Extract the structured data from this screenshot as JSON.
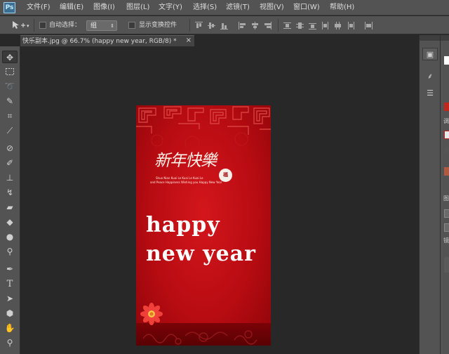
{
  "app": {
    "logo": "Ps"
  },
  "menu": [
    "文件(F)",
    "编辑(E)",
    "图像(I)",
    "图层(L)",
    "文字(Y)",
    "选择(S)",
    "滤镜(T)",
    "视图(V)",
    "窗口(W)",
    "帮助(H)"
  ],
  "options": {
    "auto_select_label": "自动选择：",
    "group_value": "组",
    "show_transform_label": "显示变换控件"
  },
  "document": {
    "tab_title": "快乐副本.jpg @ 66.7% (happy  new year, RGB/8) *",
    "close_glyph": "×"
  },
  "tools": [
    {
      "name": "move-tool",
      "icon": "move-icon"
    },
    {
      "name": "marquee-tool",
      "icon": "marquee-icon"
    },
    {
      "name": "lasso-tool",
      "icon": "lasso-icon"
    },
    {
      "name": "quick-select-tool",
      "icon": "quick-select-icon"
    },
    {
      "name": "crop-tool",
      "icon": "crop-icon"
    },
    {
      "name": "eyedropper-tool",
      "icon": "eyedropper-icon"
    },
    {
      "name": "healing-brush-tool",
      "icon": "bandage-icon"
    },
    {
      "name": "brush-tool",
      "icon": "brush-icon"
    },
    {
      "name": "clone-stamp-tool",
      "icon": "stamp-icon"
    },
    {
      "name": "history-brush-tool",
      "icon": "history-brush-icon"
    },
    {
      "name": "eraser-tool",
      "icon": "eraser-icon"
    },
    {
      "name": "gradient-tool",
      "icon": "bucket-icon"
    },
    {
      "name": "blur-tool",
      "icon": "drop-icon"
    },
    {
      "name": "dodge-tool",
      "icon": "dodge-icon"
    },
    {
      "name": "pen-tool",
      "icon": "pen-icon"
    },
    {
      "name": "type-tool",
      "icon": "type-icon"
    },
    {
      "name": "path-select-tool",
      "icon": "arrow-icon"
    },
    {
      "name": "shape-tool",
      "icon": "hexagon-icon"
    },
    {
      "name": "hand-tool",
      "icon": "hand-icon"
    },
    {
      "name": "zoom-tool",
      "icon": "zoom-icon"
    }
  ],
  "image": {
    "title_cn": "新年快樂",
    "seal_text": "福",
    "subtitle_1": "Shuo Nian Kuai Le Kuai Le Kuai Le",
    "subtitle_2": "and Peace Happiness Wishing you Happy New Year",
    "line1": "happy",
    "line2": "new year"
  },
  "right_panel": {
    "tab_1": "调",
    "tab_2": "图",
    "tab_3": "镜",
    "swatch_red": "#c0281e",
    "swatch_brown": "#b05a40"
  }
}
